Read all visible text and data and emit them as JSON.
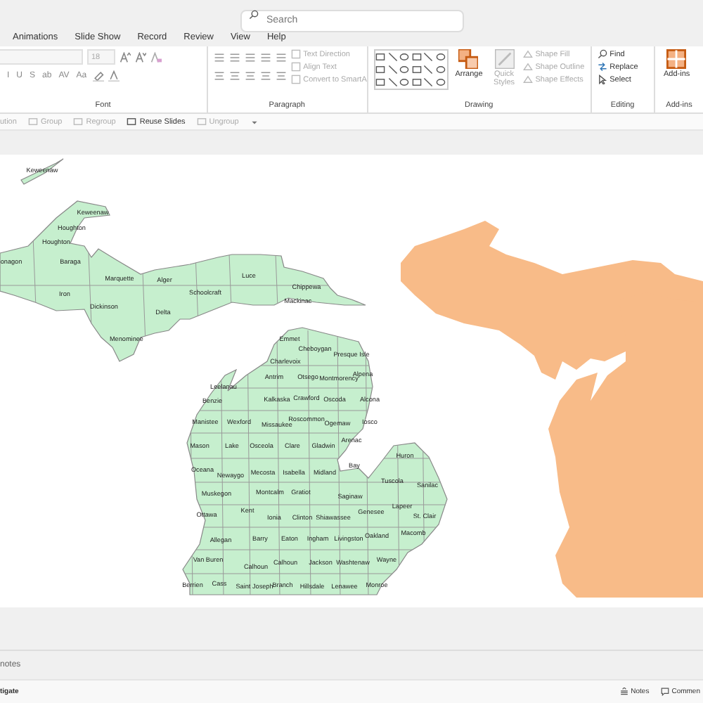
{
  "search": {
    "placeholder": "Search"
  },
  "menu_tabs": [
    {
      "label": "Animations",
      "selected": false
    },
    {
      "label": "Slide Show",
      "selected": false
    },
    {
      "label": "Record",
      "selected": false
    },
    {
      "label": "Review",
      "selected": false
    },
    {
      "label": "View",
      "selected": false
    },
    {
      "label": "Help",
      "selected": false
    }
  ],
  "ribbon": {
    "font": {
      "size": "18",
      "format_buttons": [
        "I",
        "U",
        "S",
        "ab",
        "AV",
        "Aa"
      ],
      "label": "Font"
    },
    "paragraph": {
      "buttons": [
        {
          "label": "Text Direction",
          "disabled": true
        },
        {
          "label": "Align Text",
          "disabled": true
        },
        {
          "label": "Convert to SmartA",
          "disabled": true
        }
      ],
      "label": "Paragraph"
    },
    "drawing": {
      "arrange": {
        "label": "Arrange",
        "disabled": false
      },
      "quick_styles": {
        "label": "Quick Styles",
        "disabled": true
      },
      "buttons": [
        {
          "label": "Shape Fill",
          "disabled": true
        },
        {
          "label": "Shape Outline",
          "disabled": true
        },
        {
          "label": "Shape Effects",
          "disabled": true
        }
      ],
      "label": "Drawing"
    },
    "editing": {
      "buttons": [
        {
          "label": "Find",
          "disabled": false
        },
        {
          "label": "Replace",
          "disabled": false
        },
        {
          "label": "Select",
          "disabled": false
        }
      ],
      "label": "Editing"
    },
    "addins": {
      "button": "Add-ins",
      "label": "Add-ins"
    }
  },
  "quick_toolbar": [
    {
      "label": "ution",
      "disabled": true
    },
    {
      "label": "Group",
      "disabled": true
    },
    {
      "label": "Regroup",
      "disabled": true
    },
    {
      "label": "Reuse Slides",
      "disabled": false
    },
    {
      "label": "Ungroup",
      "disabled": true
    }
  ],
  "map": {
    "counties": [
      "Keweenaw",
      "Keweenaw",
      "Houghton",
      "Houghton",
      "onagon",
      "Baraga",
      "Iron",
      "Marquette",
      "Alger",
      "Luce",
      "Chippewa",
      "Schoolcraft",
      "Mackinac",
      "Dickinson",
      "Delta",
      "Menominee",
      "Emmet",
      "Charlevoix",
      "Cheboygan",
      "Presque Isle",
      "Antrim",
      "Otsego",
      "Montmorency",
      "Alpena",
      "Leelanau",
      "Benzie",
      "Kalkaska",
      "Crawford",
      "Oscoda",
      "Alcona",
      "Manistee",
      "Wexford",
      "Missaukee",
      "Roscommon",
      "Ogemaw",
      "Iosco",
      "Mason",
      "Lake",
      "Osceola",
      "Clare",
      "Gladwin",
      "Arenac",
      "Huron",
      "Oceana",
      "Newaygo",
      "Mecosta",
      "Isabella",
      "Midland",
      "Bay",
      "Tuscola",
      "Sanilac",
      "Muskegon",
      "Montcalm",
      "Gratiot",
      "Saginaw",
      "Ottawa",
      "Kent",
      "Ionia",
      "Clinton",
      "Shiawassee",
      "Genesee",
      "Lapeer",
      "St. Clair",
      "Allegan",
      "Barry",
      "Eaton",
      "Ingham",
      "Livingston",
      "Oakland",
      "Macomb",
      "Van Buren",
      "Calhoun",
      "Calhoun",
      "Jackson",
      "Washtenaw",
      "Wayne",
      "Berrien",
      "Cass",
      "Saint Joseph",
      "Branch",
      "Hillsdale",
      "Lenawee",
      "Monroe"
    ]
  },
  "notes_pane": {
    "text": "notes"
  },
  "status_bar": {
    "left": "tigate",
    "buttons": [
      "Notes",
      "Commen"
    ]
  }
}
